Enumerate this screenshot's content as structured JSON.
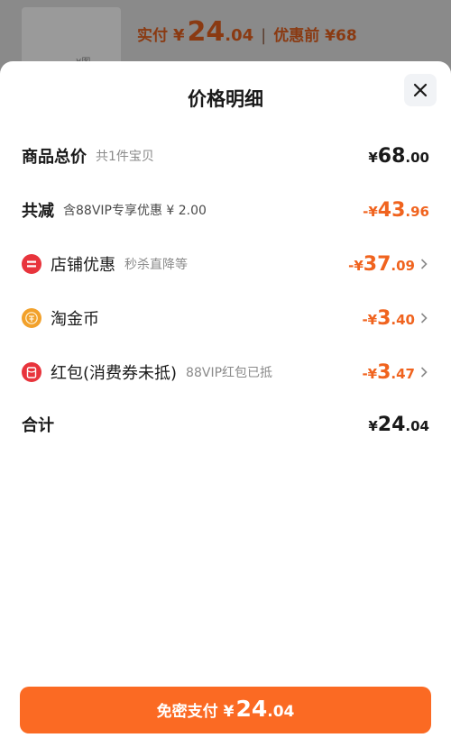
{
  "background": {
    "thumb_text": "¥图",
    "paid_label": "实付",
    "paid_yen": "¥",
    "paid_int": "24",
    "paid_dec": ".04",
    "separator": "|",
    "before_discount": "优惠前 ¥68"
  },
  "sheet": {
    "title": "价格明细",
    "close_icon": "close-icon"
  },
  "rows": {
    "total": {
      "label": "商品总价",
      "sub": "共1件宝贝",
      "yen": "¥",
      "int": "68",
      "dec": ".00"
    },
    "reduce": {
      "label": "共减",
      "sub": "含88VIP专享优惠 ¥ 2.00",
      "yen": "-¥",
      "int": "43",
      "dec": ".96"
    },
    "store": {
      "label": "店铺优惠",
      "sub": "秒杀直降等",
      "yen": "-¥",
      "int": "37",
      "dec": ".09",
      "icon": "store-discount-icon"
    },
    "coins": {
      "label": "淘金币",
      "yen": "-¥",
      "int": "3",
      "dec": ".40",
      "icon": "coin-icon"
    },
    "redpacket": {
      "label": "红包(消费券未抵)",
      "sub": "88VIP红包已抵",
      "yen": "-¥",
      "int": "3",
      "dec": ".47",
      "icon": "red-packet-icon"
    },
    "sum": {
      "label": "合计",
      "yen": "¥",
      "int": "24",
      "dec": ".04"
    }
  },
  "pay_button": {
    "label": "免密支付",
    "yen": "¥",
    "int": "24",
    "dec": ".04"
  },
  "colors": {
    "accent": "#fb6a23",
    "discount": "#f0631e",
    "red_icon": "#e8343c",
    "coin_icon": "#f2a12b"
  }
}
